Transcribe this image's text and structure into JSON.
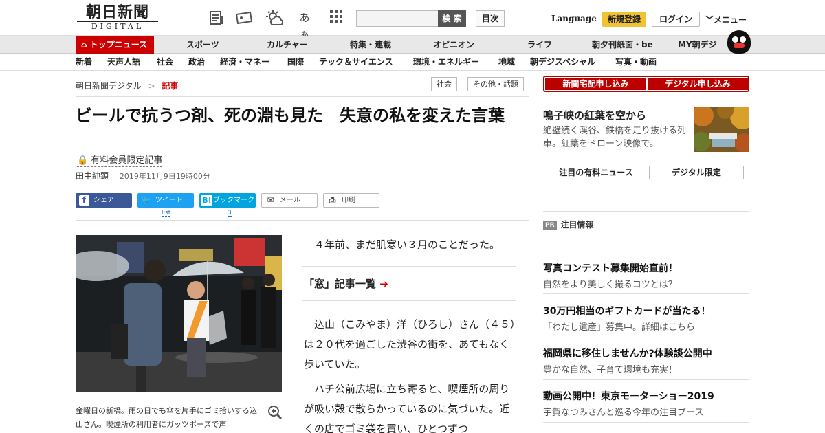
{
  "header": {
    "logo_top": "朝日新聞",
    "logo_bottom": "DIGITAL",
    "search_placeholder": "",
    "search_button": "検 索",
    "index_button": "目次",
    "language": "Language",
    "register": "新規登録",
    "login": "ログイン",
    "menu": "メニュー",
    "font_toggle": "あぁ"
  },
  "nav_main": [
    {
      "label": "トップニュース",
      "active": true
    },
    {
      "label": "スポーツ"
    },
    {
      "label": "カルチャー"
    },
    {
      "label": "特集・連載"
    },
    {
      "label": "オピニオン"
    },
    {
      "label": "ライフ"
    },
    {
      "label": "朝夕刊紙面・be"
    },
    {
      "label": "MY朝デジ"
    }
  ],
  "nav_sub": [
    "新着",
    "天声人語",
    "社会",
    "政治",
    "経済・マネー",
    "国際",
    "テック＆サイエンス",
    "環境・エネルギー",
    "地域",
    "朝デジスペシャル",
    "写真・動画"
  ],
  "breadcrumb": {
    "home": "朝日新聞デジタル",
    "sep": ">",
    "current": "記事"
  },
  "tags": [
    "社会",
    "その他・話題"
  ],
  "article": {
    "title": "ビールで抗うつ剤、死の淵も見た　失意の私を変えた言葉",
    "member_label": "有料会員限定記事",
    "author": "田中紳顕",
    "date": "2019年11月9日19時00分",
    "share": {
      "facebook": "シェア",
      "twitter": "ツイート",
      "twitter_count": "list",
      "hatena": "ブックマーク",
      "hatena_count": "3",
      "mail": "メール",
      "print": "印刷"
    },
    "caption": "金曜日の新橋。雨の日でも傘を片手にゴミ拾いする込山さん。喫煙所の利用者にガッツポーズで声",
    "lead": "４年前、まだ肌寒い３月のことだった。",
    "list_link": "「窓」記事一覧",
    "para1": "込山（こみやま）洋（ひろし）さん（４５）は２０代を過ごした渋谷の街を、あてもなく歩いていた。",
    "para2": "ハチ公前広場に立ち寄ると、喫煙所の周りが吸い殻で散らかっているのに気づいた。近くの店でゴミ袋を買い、ひとつずつ"
  },
  "sidebar": {
    "subscribe_paper": "新聞宅配申し込み",
    "subscribe_digital": "デジタル申し込み",
    "feature_title": "鳴子峡の紅葉を空から",
    "feature_desc": "絶壁続く渓谷、鉄橋を走り抜ける列車。紅葉をドローン映像で。",
    "tab_paid": "注目の有料ニュース",
    "tab_digital": "デジタル限定",
    "pr_badge": "PR",
    "pr_label": "注目情報",
    "ads": [
      {
        "title": "写真コンテスト募集開始直前！",
        "desc": "自然をより美しく撮るコツとは？"
      },
      {
        "title": "30万円相当のギフトカードが当たる！",
        "desc": "「わたし遺産」募集中。詳細はこちら"
      },
      {
        "title": "福岡県に移住しませんか?体験談公開中",
        "desc": "豊かな自然、子育て環境も充実！"
      },
      {
        "title": "動画公開中！東京モーターショー2019",
        "desc": "宇賀なつみさんと巡る今年の注目ブース"
      }
    ]
  },
  "colors": {
    "accent": "#cc0000",
    "facebook": "#3b5998",
    "twitter": "#1da1f2",
    "hatena": "#00a4de",
    "register": "#f1c232"
  }
}
